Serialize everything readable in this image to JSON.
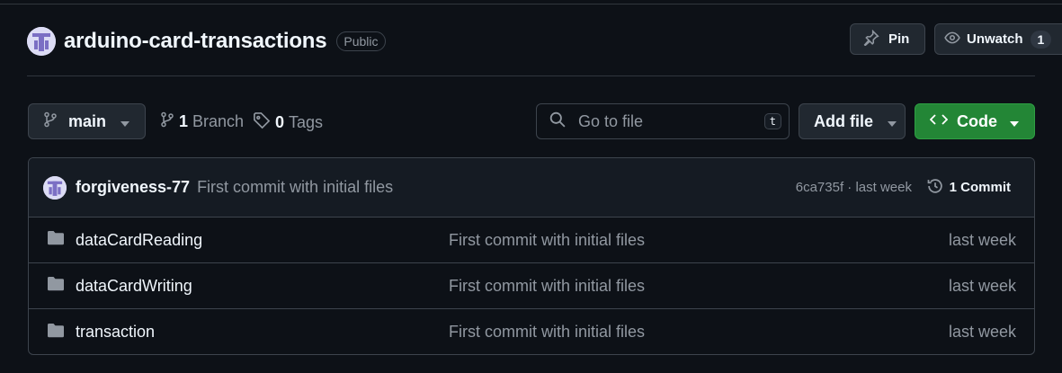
{
  "repo": {
    "name": "arduino-card-transactions",
    "visibility": "Public"
  },
  "actions": {
    "pin_label": "Pin",
    "watch_label": "Unwatch",
    "watch_count": "1"
  },
  "toolbar": {
    "branch": "main",
    "branches_count": "1",
    "branches_label": "Branch",
    "tags_count": "0",
    "tags_label": "Tags",
    "search_placeholder": "Go to file",
    "search_shortcut": "t",
    "add_file_label": "Add file",
    "code_label": "Code"
  },
  "latest_commit": {
    "author": "forgiveness-77",
    "message": "First commit with initial files",
    "meta": "6ca735f · last week",
    "commits_label": "1 Commit"
  },
  "files": [
    {
      "name": "dataCardReading",
      "message": "First commit with initial files",
      "date": "last week"
    },
    {
      "name": "dataCardWriting",
      "message": "First commit with initial files",
      "date": "last week"
    },
    {
      "name": "transaction",
      "message": "First commit with initial files",
      "date": "last week"
    }
  ],
  "colors": {
    "background": "#0d1117",
    "border": "#3d444d",
    "muted_text": "#9198a1",
    "code_button": "#238636",
    "folder_icon": "#9198a1"
  },
  "icons": {
    "avatar": "identicon-avatar",
    "pin": "pin-icon",
    "watch": "eye-icon",
    "branch": "git-branch-icon",
    "tag": "tag-icon",
    "search": "search-icon",
    "code": "code-icon",
    "history": "history-icon",
    "folder": "folder-icon"
  }
}
